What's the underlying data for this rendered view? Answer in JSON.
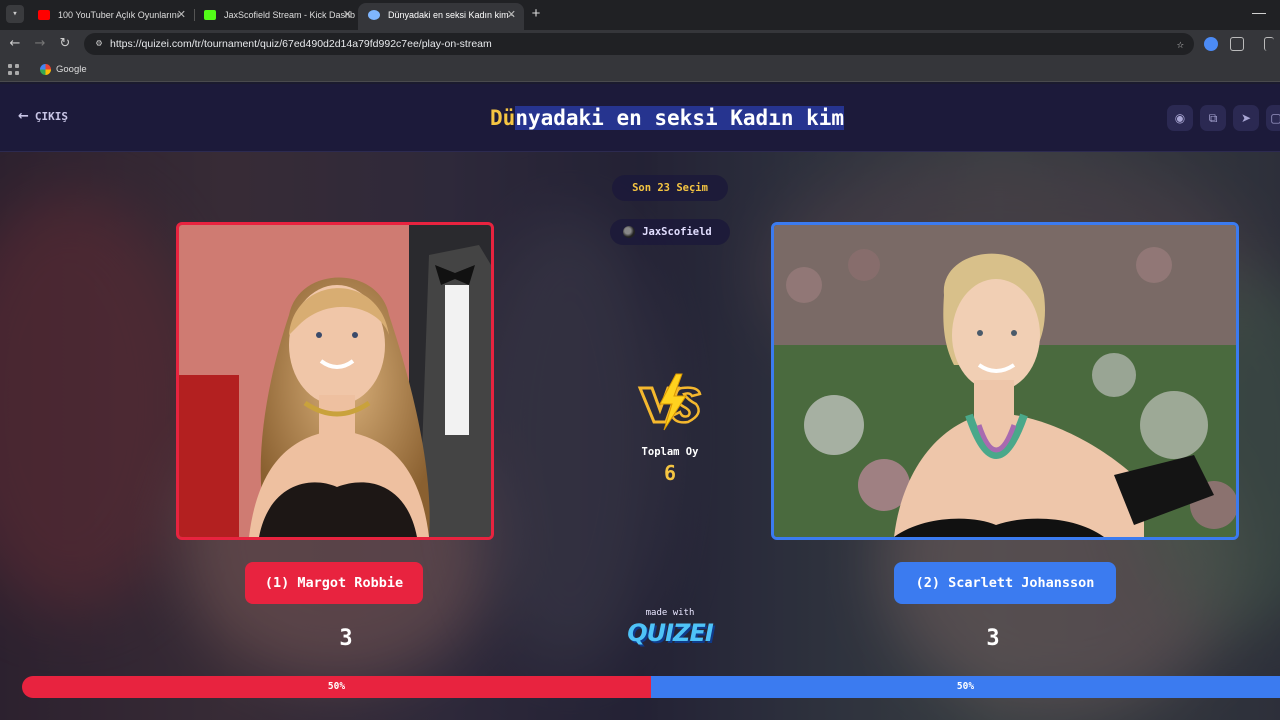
{
  "browser": {
    "tabs": [
      {
        "title": "100 YouTuber Açlık Oyunlarını",
        "favicon": "youtube-icon",
        "color": "#ff0000"
      },
      {
        "title": "JaxScofield Stream - Kick Dashb",
        "favicon": "kick-icon",
        "color": "#53fc18"
      },
      {
        "title": "Dünyadaki en seksi Kadın kim -",
        "favicon": "quizei-icon",
        "color": "#7fb6ff",
        "active": true
      }
    ],
    "url": "https://quizei.com/tr/tournament/quiz/67ed490d2d14a79fd992c7ee/play-on-stream",
    "bookmarks": [
      {
        "label": "Google"
      }
    ]
  },
  "header": {
    "exit_label": "ÇIKIŞ",
    "title_first": "D",
    "title_second": "ü",
    "title_rest": "nyadaki en seksi Kadın kim"
  },
  "round": {
    "label": "Son 23 Seçim",
    "streamer": "JaxScofield",
    "total_label": "Toplam Oy",
    "total_votes": "6"
  },
  "contestants": [
    {
      "label": "(1) Margot Robbie",
      "votes": "3",
      "percent_label": "50%",
      "share": 0.5,
      "color": "#e8233f"
    },
    {
      "label": "(2) Scarlett Johansson",
      "votes": "3",
      "percent_label": "50%",
      "share": 0.5,
      "color": "#3b7bf0"
    }
  ],
  "footer": {
    "made_with": "made with",
    "brand": "QUIZEI"
  }
}
